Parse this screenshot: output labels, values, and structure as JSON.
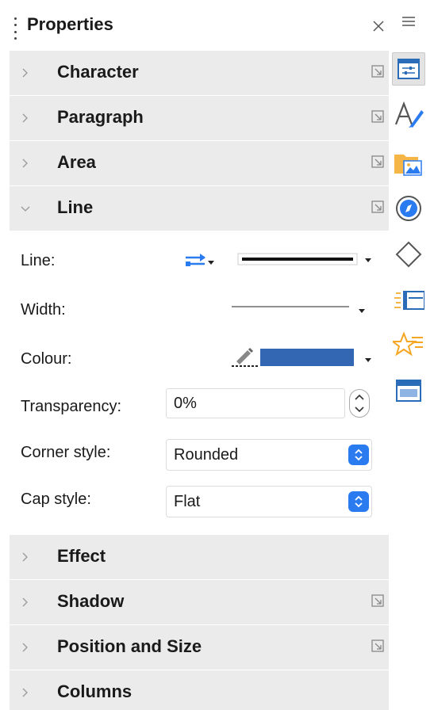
{
  "panel": {
    "title": "Properties",
    "close_icon": "close-icon",
    "grip_icon": "grip-handle-icon"
  },
  "sections_top": [
    {
      "label": "Character",
      "expanded": false,
      "has_more": true
    },
    {
      "label": "Paragraph",
      "expanded": false,
      "has_more": true
    },
    {
      "label": "Area",
      "expanded": false,
      "has_more": true
    },
    {
      "label": "Line",
      "expanded": true,
      "has_more": true
    }
  ],
  "line": {
    "line_label": "Line:",
    "width_label": "Width:",
    "colour_label": "Colour:",
    "colour_value": "#3366b3",
    "transparency_label": "Transparency:",
    "transparency_value": "0%",
    "corner_style_label": "Corner style:",
    "corner_style_value": "Rounded",
    "cap_style_label": "Cap style:",
    "cap_style_value": "Flat"
  },
  "sections_bottom": [
    {
      "label": "Effect",
      "expanded": false,
      "has_more": false
    },
    {
      "label": "Shadow",
      "expanded": false,
      "has_more": true
    },
    {
      "label": "Position and Size",
      "expanded": false,
      "has_more": true
    },
    {
      "label": "Columns",
      "expanded": false,
      "has_more": false
    }
  ],
  "tabbar": {
    "menu_icon": "hamburger-menu-icon",
    "tabs": [
      {
        "icon": "properties-icon",
        "active": true
      },
      {
        "icon": "styles-icon",
        "active": false
      },
      {
        "icon": "gallery-icon",
        "active": false
      },
      {
        "icon": "navigator-icon",
        "active": false
      },
      {
        "icon": "shapes-icon",
        "active": false
      },
      {
        "icon": "page-icon",
        "active": false
      },
      {
        "icon": "animation-icon",
        "active": false
      },
      {
        "icon": "slide-transition-icon",
        "active": false
      }
    ]
  },
  "colors": {
    "section_bg": "#ebebeb",
    "accent_blue": "#2b7bf0"
  }
}
